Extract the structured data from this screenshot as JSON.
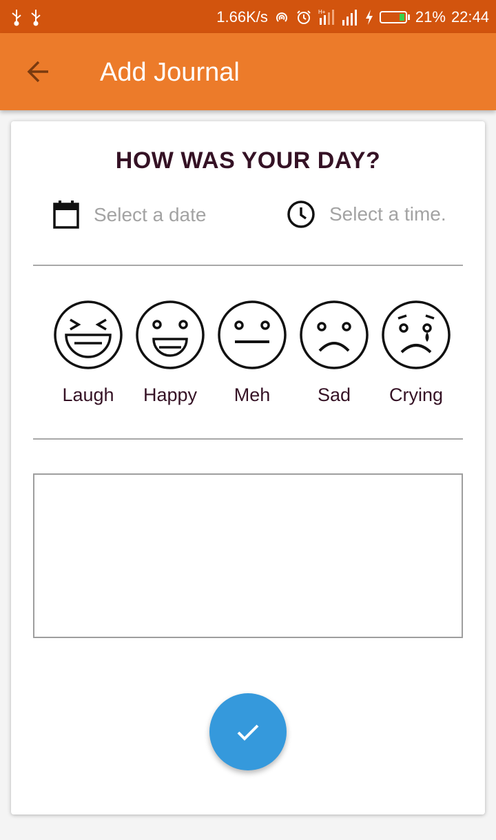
{
  "status_bar": {
    "net_speed": "1.66K/s",
    "battery": "21%",
    "time": "22:44",
    "icons": [
      "usb-icon",
      "usb-icon",
      "hotspot-icon",
      "alarm-icon",
      "h-plus-signal-icon",
      "signal-icon",
      "charging-icon",
      "battery-icon"
    ]
  },
  "app_bar": {
    "title": "Add Journal",
    "back_icon": "arrow-back-icon"
  },
  "form": {
    "heading": "HOW WAS YOUR DAY?",
    "date_placeholder": "Select a date",
    "time_placeholder": "Select a time.",
    "date_icon": "calendar-icon",
    "time_icon": "clock-icon",
    "moods": [
      {
        "label": "Laugh",
        "icon": "laugh-face-icon"
      },
      {
        "label": "Happy",
        "icon": "happy-face-icon"
      },
      {
        "label": "Meh",
        "icon": "meh-face-icon"
      },
      {
        "label": "Sad",
        "icon": "sad-face-icon"
      },
      {
        "label": "Crying",
        "icon": "crying-face-icon"
      }
    ],
    "note_value": "",
    "submit_icon": "check-icon"
  },
  "colors": {
    "status_bar": "#d2540e",
    "app_bar": "#ec7b2a",
    "heading": "#351225",
    "placeholder": "#a3a3a3",
    "fab": "#3599dc",
    "battery_fill": "#3ad14a"
  }
}
